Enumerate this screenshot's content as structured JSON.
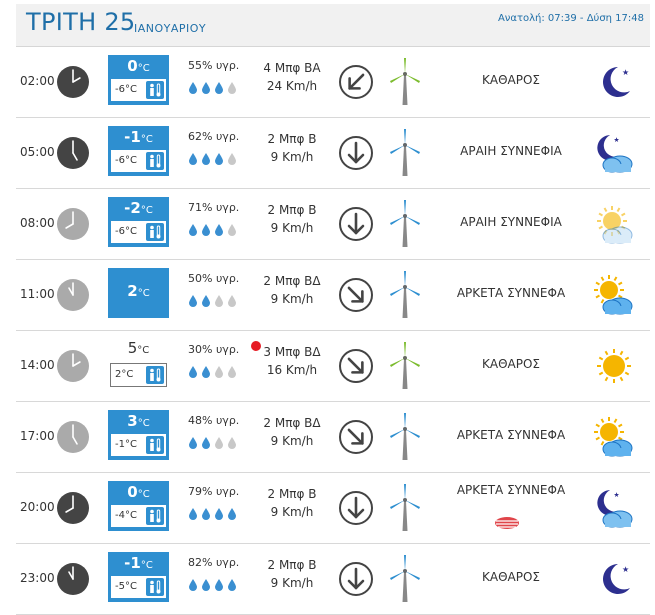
{
  "header": {
    "day": "ΤΡΙΤΗ 25",
    "month": "ΙΑΝΟΥΑΡΙΟΥ",
    "sun_times": "Ανατολή: 07:39 - Δύση 17:48"
  },
  "colors": {
    "accent": "#2e8fd0",
    "title": "#1f6fa8",
    "drop_full": "#3a8fd1",
    "drop_empty": "#c8c8c8",
    "turbine_green": "#7cbc2e",
    "turbine_blue": "#2e8fd0",
    "hot_dot": "#e61c24"
  },
  "rows": [
    {
      "time": "02:00",
      "clock": "dark",
      "temp": "0",
      "unit": "°C",
      "feels": "-6°C",
      "style": "blue",
      "humidity": "55% υγρ.",
      "drops": 3,
      "wind_force": "4 Μπφ ΒΑ",
      "wind_speed": "24 Km/h",
      "arrow": "south-west-arrow-icon",
      "turbine": "green",
      "condition": "ΚΑΘΑΡΟΣ",
      "weather": "moon-icon"
    },
    {
      "time": "05:00",
      "clock": "dark",
      "temp": "-1",
      "unit": "°C",
      "feels": "-6°C",
      "style": "blue",
      "humidity": "62% υγρ.",
      "drops": 3,
      "wind_force": "2 Μπφ Β",
      "wind_speed": "9 Km/h",
      "arrow": "south-arrow-icon",
      "turbine": "blue",
      "condition": "ΑΡΑΙΗ ΣΥΝΝΕΦΙΑ",
      "weather": "moon-cloud-icon"
    },
    {
      "time": "08:00",
      "clock": "light",
      "temp": "-2",
      "unit": "°C",
      "feels": "-6°C",
      "style": "blue",
      "humidity": "71% υγρ.",
      "drops": 3,
      "wind_force": "2 Μπφ Β",
      "wind_speed": "9 Km/h",
      "arrow": "south-arrow-icon",
      "turbine": "blue",
      "condition": "ΑΡΑΙΗ ΣΥΝΝΕΦΙΑ",
      "weather": "sun-faint-cloud-icon"
    },
    {
      "time": "11:00",
      "clock": "light",
      "temp": "2",
      "unit": "°C",
      "feels": "",
      "style": "single",
      "humidity": "50% υγρ.",
      "drops": 2,
      "wind_force": "2 Μπφ ΒΔ",
      "wind_speed": "9 Km/h",
      "arrow": "south-east-arrow-icon",
      "turbine": "blue",
      "condition": "ΑΡΚΕΤΑ ΣΥΝΝΕΦΑ",
      "weather": "sun-cloud-icon"
    },
    {
      "time": "14:00",
      "clock": "light",
      "temp": "5",
      "unit": "°C",
      "feels": "2°C",
      "style": "plain",
      "humidity": "30% υγρ.",
      "drops": 2,
      "wind_force": "3 Μπφ ΒΔ",
      "wind_speed": "16 Km/h",
      "arrow": "south-east-arrow-icon",
      "turbine": "green",
      "condition": "ΚΑΘΑΡΟΣ",
      "weather": "sun-icon"
    },
    {
      "time": "17:00",
      "clock": "light",
      "temp": "3",
      "unit": "°C",
      "feels": "-1°C",
      "style": "blue",
      "humidity": "48% υγρ.",
      "drops": 2,
      "wind_force": "2 Μπφ ΒΔ",
      "wind_speed": "9 Km/h",
      "arrow": "south-east-arrow-icon",
      "turbine": "blue",
      "condition": "ΑΡΚΕΤΑ ΣΥΝΝΕΦΑ",
      "weather": "sun-cloud-icon"
    },
    {
      "time": "20:00",
      "clock": "dark",
      "temp": "0",
      "unit": "°C",
      "feels": "-4°C",
      "style": "blue",
      "humidity": "79% υγρ.",
      "drops": 4,
      "wind_force": "2 Μπφ Β",
      "wind_speed": "9 Km/h",
      "arrow": "south-arrow-icon",
      "turbine": "blue",
      "condition": "ΑΡΚΕΤΑ ΣΥΝΝΕΦΑ",
      "weather": "moon-cloud-icon",
      "fog": true
    },
    {
      "time": "23:00",
      "clock": "dark",
      "temp": "-1",
      "unit": "°C",
      "feels": "-5°C",
      "style": "blue",
      "humidity": "82% υγρ.",
      "drops": 4,
      "wind_force": "2 Μπφ Β",
      "wind_speed": "9 Km/h",
      "arrow": "south-arrow-icon",
      "turbine": "blue",
      "condition": "ΚΑΘΑΡΟΣ",
      "weather": "moon-icon"
    }
  ]
}
